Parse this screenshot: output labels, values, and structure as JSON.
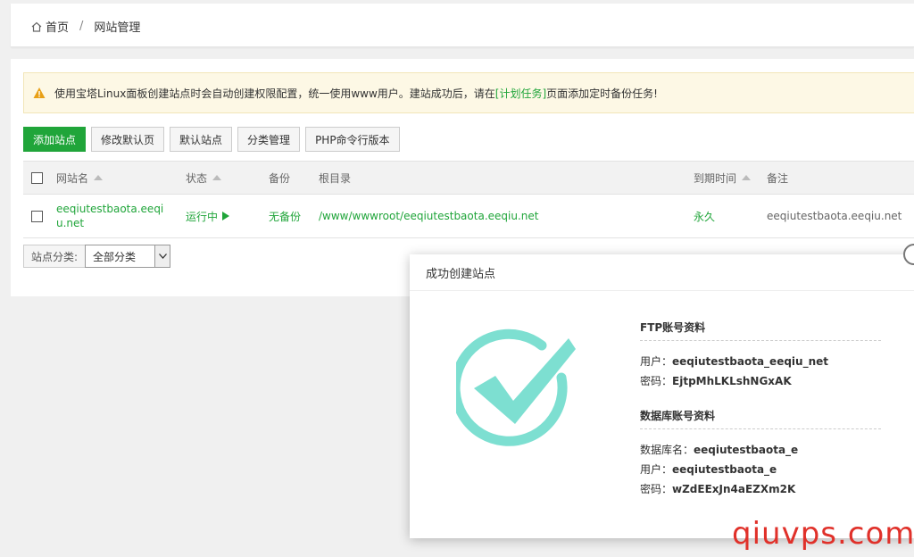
{
  "breadcrumb": {
    "home": "首页",
    "separator": "/",
    "current": "网站管理"
  },
  "notice": {
    "text_before": "使用宝塔Linux面板创建站点时会自动创建权限配置，统一使用www用户。建站成功后，请在",
    "link": "[计划任务]",
    "text_after": "页面添加定时备份任务!"
  },
  "toolbar": {
    "add_site": "添加站点",
    "edit_default_page": "修改默认页",
    "default_site": "默认站点",
    "category_manage": "分类管理",
    "php_cli_version": "PHP命令行版本"
  },
  "table": {
    "headers": {
      "name": "网站名",
      "status": "状态",
      "backup": "备份",
      "root": "根目录",
      "expire": "到期时间",
      "note": "备注"
    },
    "rows": [
      {
        "name": "eeqiutestbaota.eeqiu.net",
        "status": "运行中",
        "backup": "无备份",
        "root": "/www/wwwroot/eeqiutestbaota.eeqiu.net",
        "expire": "永久",
        "note": "eeqiutestbaota.eeqiu.net"
      }
    ]
  },
  "filter": {
    "label": "站点分类:",
    "selected": "全部分类"
  },
  "dialog": {
    "title": "成功创建站点",
    "ftp_title": "FTP账号资料",
    "ftp_user_label": "用户：",
    "ftp_user": "eeqiutestbaota_eeqiu_net",
    "ftp_pass_label": "密码：",
    "ftp_pass": "EjtpMhLKLshNGxAK",
    "db_title": "数据库账号资料",
    "db_name_label": "数据库名：",
    "db_name": "eeqiutestbaota_e",
    "db_user_label": "用户：",
    "db_user": "eeqiutestbaota_e",
    "db_pass_label": "密码：",
    "db_pass": "wZdEExJn4aEZXm2K"
  },
  "watermark": "qiuvps.com",
  "colors": {
    "brand_green": "#20a53a",
    "check_teal": "#7ddfd1",
    "warning": "#e8a017",
    "watermark_red": "#e0312a"
  }
}
